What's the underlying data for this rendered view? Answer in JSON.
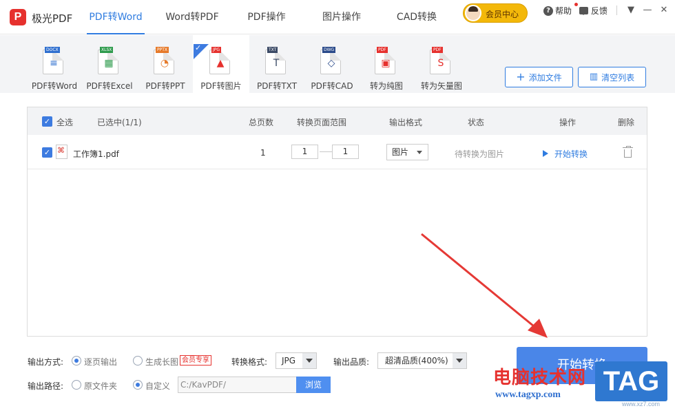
{
  "app": {
    "logo_letter": "P",
    "name": "极光PDF"
  },
  "nav_tabs": [
    {
      "label": "PDF转Word"
    },
    {
      "label": "Word转PDF"
    },
    {
      "label": "PDF操作"
    },
    {
      "label": "图片操作"
    },
    {
      "label": "CAD转换"
    }
  ],
  "header": {
    "vip_label": "会员中心",
    "help_label": "帮助",
    "feedback_label": "反馈"
  },
  "tools": [
    {
      "label": "PDF转Word",
      "tag": "DOCX",
      "tag_color": "#2f6fcf"
    },
    {
      "label": "PDF转Excel",
      "tag": "XLSX",
      "tag_color": "#2e9b4d"
    },
    {
      "label": "PDF转PPT",
      "tag": "PPTX",
      "tag_color": "#e67a2a"
    },
    {
      "label": "PDF转图片",
      "tag": "JPG",
      "tag_color": "#e6312e"
    },
    {
      "label": "PDF转TXT",
      "tag": "TXT",
      "tag_color": "#3b4a66"
    },
    {
      "label": "PDF转CAD",
      "tag": "DWG",
      "tag_color": "#2a4a8a"
    },
    {
      "label": "转为纯图",
      "tag": "PDF",
      "tag_color": "#e6312e"
    },
    {
      "label": "转为矢量图",
      "tag": "PDF",
      "tag_color": "#e6312e"
    }
  ],
  "actions": {
    "add_file": "添加文件",
    "clear_list": "清空列表"
  },
  "table": {
    "select_all": "全选",
    "selected_count": "已选中(1/1)",
    "headers": {
      "pages": "总页数",
      "range": "转换页面范围",
      "format": "输出格式",
      "status": "状态",
      "operation": "操作",
      "delete": "删除"
    },
    "rows": [
      {
        "file_name": "工作簿1.pdf",
        "pages": "1",
        "range_from": "1",
        "range_to": "1",
        "format": "图片",
        "status": "待转换为图片",
        "action": "开始转换"
      }
    ]
  },
  "options": {
    "output_mode_label": "输出方式:",
    "mode_per_page": "逐页输出",
    "mode_long_image": "生成长图",
    "vip_only": "会员专享",
    "format_label": "转换格式:",
    "format_value": "JPG",
    "quality_label": "输出品质:",
    "quality_value": "超清品质(400%)",
    "path_label": "输出路径:",
    "path_original": "原文件夹",
    "path_custom": "自定义",
    "path_value": "C:/KavPDF/",
    "browse": "浏览",
    "convert": "开始转换"
  },
  "watermark": {
    "cn": "电脑技术网",
    "url": "www.tagxp.com",
    "tag": "TAG",
    "small": "www.xz7.com"
  },
  "colors": {
    "accent": "#2f7ce0",
    "brand": "#e6312e",
    "arrow": "#e53935"
  }
}
